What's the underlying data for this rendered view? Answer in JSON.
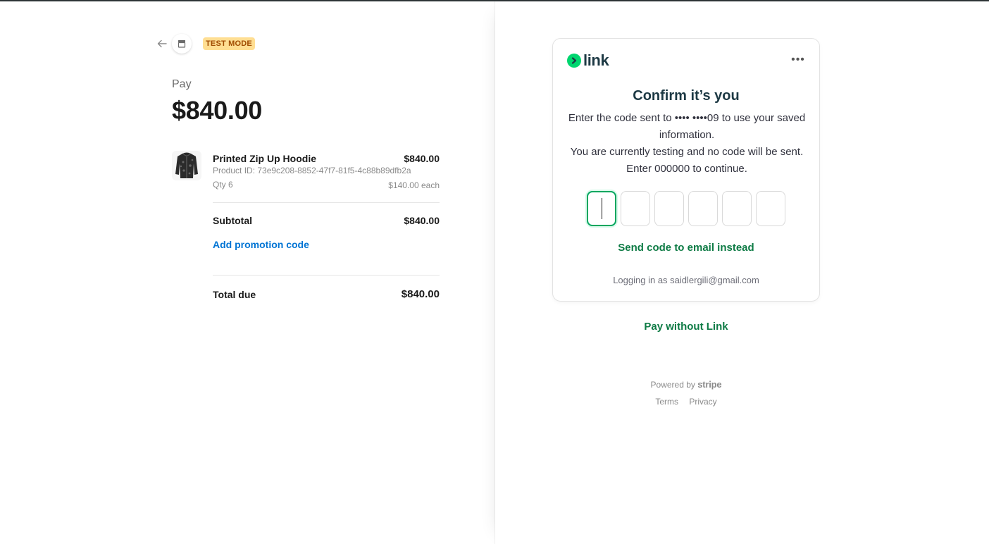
{
  "header": {
    "test_mode_badge": "TEST MODE"
  },
  "summary": {
    "pay_label": "Pay",
    "pay_amount": "$840.00"
  },
  "item": {
    "name": "Printed Zip Up Hoodie",
    "price": "$840.00",
    "product_id": "Product ID: 73e9c208-8852-47f7-81f5-4c88b89dfb2a",
    "qty": "Qty 6",
    "unit_price": "$140.00 each"
  },
  "totals": {
    "subtotal_label": "Subtotal",
    "subtotal_value": "$840.00",
    "promo_label": "Add promotion code",
    "total_label": "Total due",
    "total_value": "$840.00"
  },
  "link_card": {
    "brand": "link",
    "title": "Confirm it’s you",
    "description_1": "Enter the code sent to •••• ••••09 to use your saved information.",
    "description_2": "You are currently testing and no code will be sent. Enter 000000 to continue.",
    "send_email_label": "Send code to email instead",
    "logging_in_as": "Logging in as saidlergili@gmail.com",
    "more_label": "•••"
  },
  "pay_without_link": "Pay without Link",
  "footer": {
    "powered_by": "Powered by",
    "stripe": "stripe",
    "terms": "Terms",
    "privacy": "Privacy"
  },
  "colors": {
    "link_green": "#00d66f",
    "action_green": "#0e7b45",
    "promo_blue": "#0074d4",
    "badge_bg": "#ffde92",
    "badge_text": "#a04b00"
  },
  "icons": {
    "back": "arrow-left-icon",
    "store": "store-icon",
    "more": "more-horizontal-icon",
    "link_logo": "link-chevron-icon"
  }
}
